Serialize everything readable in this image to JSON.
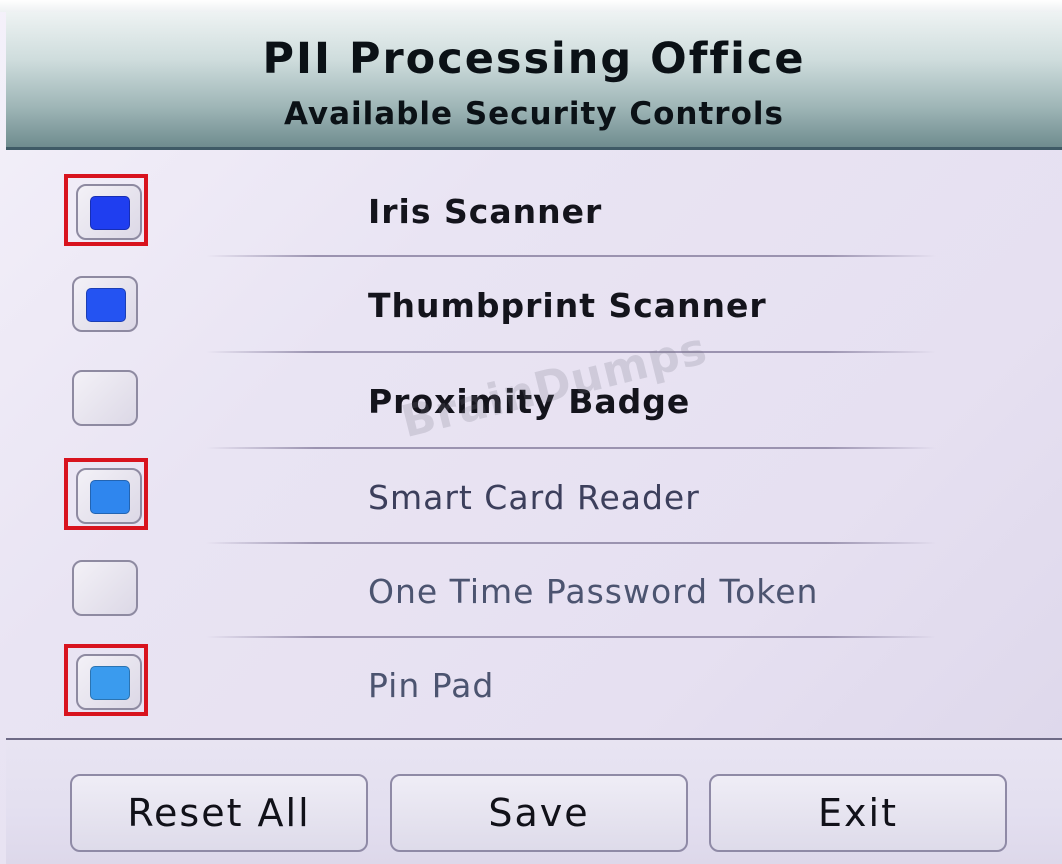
{
  "header": {
    "title": "PII Processing Office",
    "subtitle": "Available Security Controls"
  },
  "controls": [
    {
      "label": "Iris Scanner",
      "checked": true,
      "highlighted": true,
      "fill_color": "#1f3ef0"
    },
    {
      "label": "Thumbprint Scanner",
      "checked": true,
      "highlighted": false,
      "fill_color": "#2453f2"
    },
    {
      "label": "Proximity Badge",
      "checked": false,
      "highlighted": false,
      "fill_color": ""
    },
    {
      "label": "Smart Card Reader",
      "checked": true,
      "highlighted": true,
      "fill_color": "#2f86ee"
    },
    {
      "label": "One Time Password Token",
      "checked": false,
      "highlighted": false,
      "fill_color": ""
    },
    {
      "label": "Pin Pad",
      "checked": true,
      "highlighted": true,
      "fill_color": "#3a9bee"
    }
  ],
  "buttons": {
    "reset": "Reset All",
    "save": "Save",
    "exit": "Exit"
  },
  "watermark": "BrainDumps",
  "colors": {
    "highlight_border": "#d8131e",
    "header_border": "#3f5a66"
  }
}
